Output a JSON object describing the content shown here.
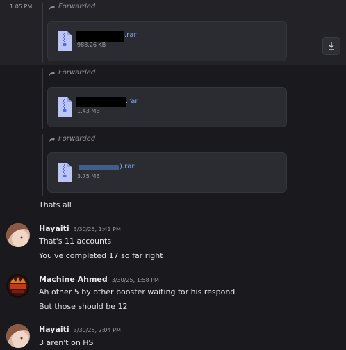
{
  "first_message": {
    "time": "1:05 PM"
  },
  "forward_label": "Forwarded",
  "files": [
    {
      "name_suffix": ".rar",
      "size": "988.26 KB"
    },
    {
      "name_suffix": ".rar",
      "size": "1.43 MB"
    },
    {
      "name_suffix": ").rar",
      "size": "3.75 MB"
    }
  ],
  "messages": [
    {
      "text": "Thats all"
    },
    {
      "author": "Hayaiti",
      "timestamp": "3/30/25, 1:41 PM",
      "lines": [
        "That's 11 accounts",
        "You've completed 17 so far right"
      ]
    },
    {
      "author": "Machine Ahmed",
      "timestamp": "3/30/25, 1:58 PM",
      "lines": [
        "Ah other 5 by other booster waiting for his respond",
        "But those should be 12"
      ]
    },
    {
      "author": "Hayaiti",
      "timestamp": "3/30/25, 2:04 PM",
      "lines": [
        "3 aren't on HS"
      ]
    }
  ],
  "icons": {
    "forward": "forward-arrow-icon",
    "file": "zip-file-icon",
    "download": "download-icon"
  },
  "colors": {
    "background": "#1a1a1e",
    "card": "#2b2c31",
    "link": "#7aa8f3",
    "muted": "#9a9ca3"
  }
}
